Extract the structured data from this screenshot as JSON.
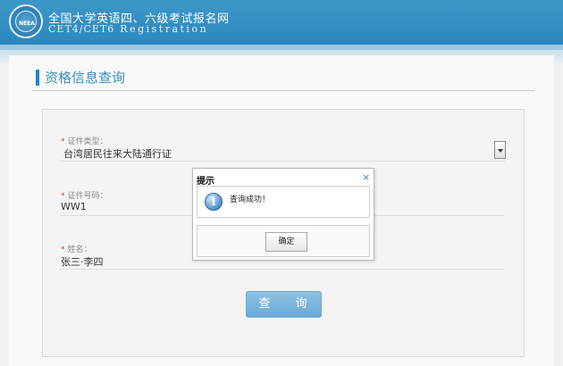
{
  "header": {
    "title_cn": "全国大学英语四、六级考试报名网",
    "title_en": "CET4/CET6",
    "title_en_sub": "Registration",
    "logo_text": "NEEA"
  },
  "page": {
    "section_title": "资格信息查询"
  },
  "form": {
    "id_type": {
      "label": "证件类型：",
      "value": "台湾居民往来大陆通行证",
      "required_mark": "*"
    },
    "id_number": {
      "label": "证件号码：",
      "value": "WW1",
      "required_mark": "*"
    },
    "name": {
      "label": "姓名：",
      "value": "张三·李四",
      "required_mark": "*"
    },
    "query_button": "查 询"
  },
  "dialog": {
    "title": "提示",
    "close": "×",
    "icon": "info-icon",
    "icon_glyph": "i",
    "message": "查询成功！",
    "ok_button": "确定"
  },
  "colors": {
    "header_blue": "#2b88bf",
    "accent_blue": "#3a8ec4",
    "button_blue": "#6aa8d6",
    "required_red": "#e53935"
  }
}
